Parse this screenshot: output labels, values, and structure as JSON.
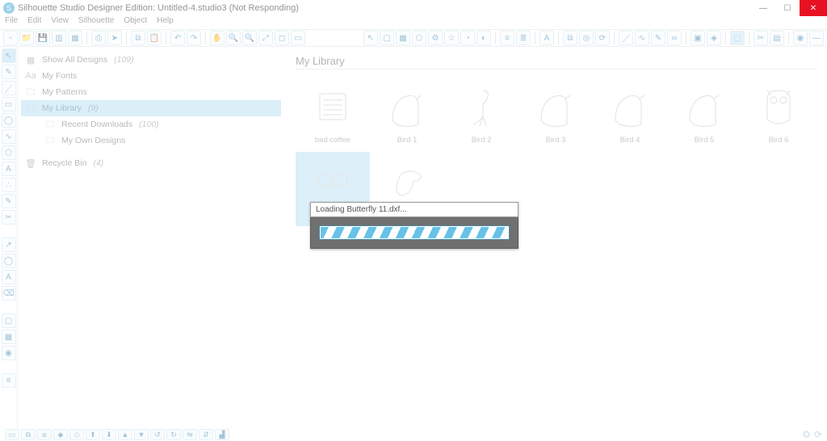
{
  "title": "Silhouette Studio Designer Edition: Untitled-4.studio3 (Not Responding)",
  "menus": [
    "File",
    "Edit",
    "View",
    "Silhouette",
    "Object",
    "Help"
  ],
  "sidebar": {
    "items": [
      {
        "icon": "grid",
        "label": "Show All Designs",
        "count": "(109)"
      },
      {
        "icon": "Aa",
        "label": "My Fonts",
        "count": ""
      },
      {
        "icon": "folder",
        "label": "My Patterns",
        "count": ""
      },
      {
        "icon": "folder",
        "label": "My Library",
        "count": "(9)"
      },
      {
        "icon": "folder",
        "label": "Recent Downloads",
        "count": "(100)"
      },
      {
        "icon": "folder",
        "label": "My Own Designs",
        "count": ""
      },
      {
        "icon": "trash",
        "label": "Recycle Bin",
        "count": "(4)"
      }
    ]
  },
  "library": {
    "title": "My Library",
    "thumbs": [
      {
        "label": "bad coffee",
        "shape": "coffee"
      },
      {
        "label": "Bird 1",
        "shape": "bird"
      },
      {
        "label": "Bird 2",
        "shape": "flamingo"
      },
      {
        "label": "Bird 3",
        "shape": "bird"
      },
      {
        "label": "Bird 4",
        "shape": "bird"
      },
      {
        "label": "Bird 5",
        "shape": "bird"
      },
      {
        "label": "Bird 6",
        "shape": "owl"
      },
      {
        "label": "",
        "shape": "butterfly",
        "selected": true
      },
      {
        "label": "",
        "shape": "toucan"
      }
    ]
  },
  "modal": {
    "text": "Loading Butterfly 11.dxf..."
  },
  "vtools_top": [
    "sel",
    "edit",
    "line",
    "rect",
    "oval",
    "curve",
    "poly",
    "text",
    "spray",
    "draw",
    "knife"
  ],
  "vtools_mid": [
    "arrow",
    "circ",
    "font",
    "erase"
  ],
  "vtools_bot": [
    "page",
    "grid",
    "globe"
  ],
  "vtools_end": [
    "layers"
  ],
  "toolbar_left": [
    "new",
    "open",
    "save",
    "lib",
    "store",
    "sep",
    "print",
    "send",
    "sep",
    "copy",
    "paste",
    "sep",
    "undo",
    "redo",
    "sep",
    "hand",
    "zoomin",
    "zoomout",
    "zoomfit",
    "zoomsel",
    "zoomarea"
  ],
  "toolbar_right": [
    "cursor",
    "page",
    "grid",
    "pentagon",
    "gear",
    "star",
    "send2",
    "trace",
    "sep",
    "align1",
    "align2",
    "sep",
    "text",
    "sep",
    "replicate",
    "offset",
    "rotate",
    "sep",
    "line",
    "sketch",
    "modify",
    "weld",
    "sep",
    "pixscan",
    "rhinestone",
    "sep",
    "select",
    "sep",
    "cut",
    "send3",
    "sep",
    "fill",
    "line2"
  ],
  "statusbar_left": [
    "sel",
    "group",
    "ungroup",
    "comp",
    "release",
    "front",
    "back",
    "fwd",
    "bkwd",
    "rotl",
    "rotr",
    "fliph",
    "flipv",
    "mirror"
  ]
}
